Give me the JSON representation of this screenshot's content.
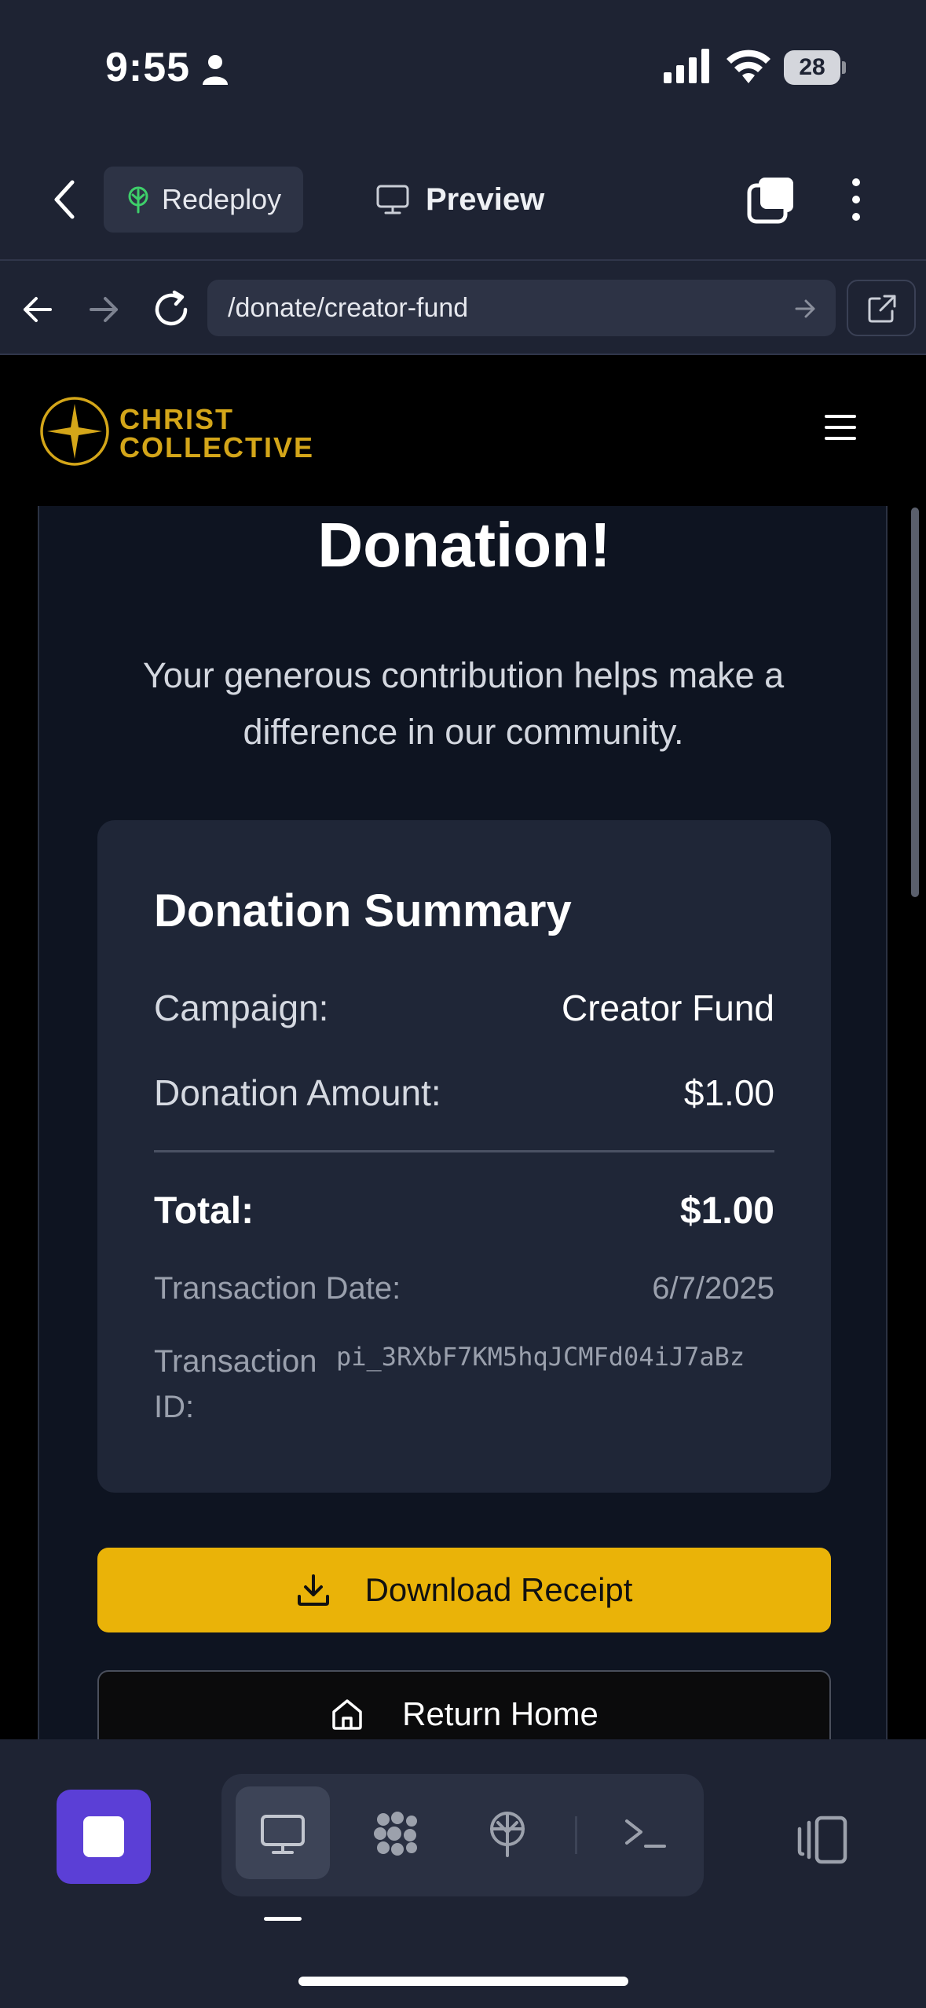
{
  "status_bar": {
    "time": "9:55",
    "battery": "28"
  },
  "app_header": {
    "redeploy_label": "Redeploy",
    "preview_label": "Preview"
  },
  "browser": {
    "url": "/donate/creator-fund"
  },
  "site": {
    "logo_line1": "CHRIST",
    "logo_line2": "COLLECTIVE",
    "brand_color": "#d4a619"
  },
  "hero": {
    "title": "Donation!",
    "subtitle": "Your generous contribution helps make a difference in our community."
  },
  "summary": {
    "title": "Donation Summary",
    "campaign_label": "Campaign:",
    "campaign_value": "Creator Fund",
    "amount_label": "Donation Amount:",
    "amount_value": "$1.00",
    "total_label": "Total:",
    "total_value": "$1.00",
    "date_label": "Transaction Date:",
    "date_value": "6/7/2025",
    "txid_label": "Transaction ID:",
    "txid_value": "pi_3RXbF7KM5hqJCMFd04iJ7aBz"
  },
  "actions": {
    "download_label": "Download Receipt",
    "home_label": "Return Home",
    "download_color": "#eab308"
  },
  "bottom_bar": {
    "icons": [
      "stop-icon",
      "desktop-icon",
      "cluster-icon",
      "deploy-icon",
      "terminal-icon",
      "device-layout-icon"
    ],
    "accent_color": "#5b3fd6"
  }
}
